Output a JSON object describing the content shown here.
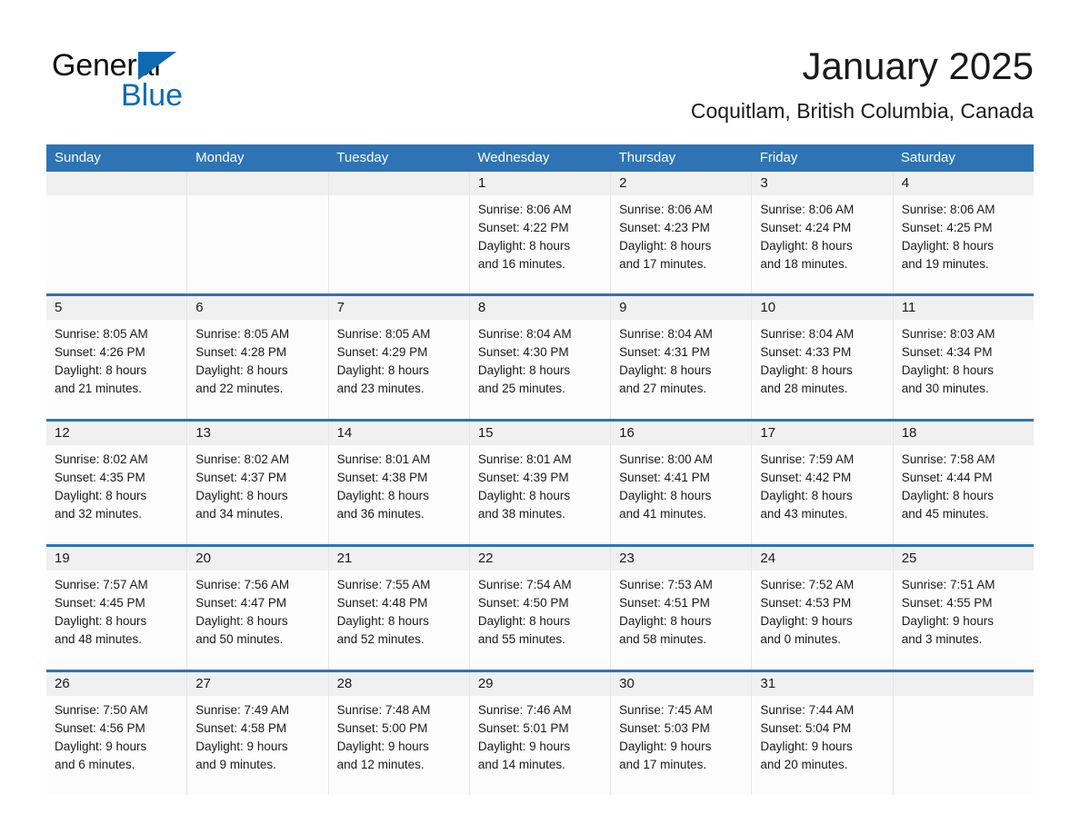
{
  "logo": {
    "word_one": "General",
    "word_two": "Blue",
    "triangle_color": "#0f6ab4",
    "icon": "triangle-icon"
  },
  "header": {
    "month_title": "January 2025",
    "location": "Coquitlam, British Columbia, Canada"
  },
  "theme": {
    "header_blue": "#2e74b5",
    "day_bar_gray": "#f0f0f0",
    "cell_background": "#fcfcfc",
    "text_color": "#1a1a1a"
  },
  "weekdays": [
    "Sunday",
    "Monday",
    "Tuesday",
    "Wednesday",
    "Thursday",
    "Friday",
    "Saturday"
  ],
  "weeks": [
    [
      {
        "empty": true
      },
      {
        "empty": true
      },
      {
        "empty": true
      },
      {
        "day": "1",
        "sunrise": "Sunrise: 8:06 AM",
        "sunset": "Sunset: 4:22 PM",
        "daylight1": "Daylight: 8 hours",
        "daylight2": "and 16 minutes."
      },
      {
        "day": "2",
        "sunrise": "Sunrise: 8:06 AM",
        "sunset": "Sunset: 4:23 PM",
        "daylight1": "Daylight: 8 hours",
        "daylight2": "and 17 minutes."
      },
      {
        "day": "3",
        "sunrise": "Sunrise: 8:06 AM",
        "sunset": "Sunset: 4:24 PM",
        "daylight1": "Daylight: 8 hours",
        "daylight2": "and 18 minutes."
      },
      {
        "day": "4",
        "sunrise": "Sunrise: 8:06 AM",
        "sunset": "Sunset: 4:25 PM",
        "daylight1": "Daylight: 8 hours",
        "daylight2": "and 19 minutes."
      }
    ],
    [
      {
        "day": "5",
        "sunrise": "Sunrise: 8:05 AM",
        "sunset": "Sunset: 4:26 PM",
        "daylight1": "Daylight: 8 hours",
        "daylight2": "and 21 minutes."
      },
      {
        "day": "6",
        "sunrise": "Sunrise: 8:05 AM",
        "sunset": "Sunset: 4:28 PM",
        "daylight1": "Daylight: 8 hours",
        "daylight2": "and 22 minutes."
      },
      {
        "day": "7",
        "sunrise": "Sunrise: 8:05 AM",
        "sunset": "Sunset: 4:29 PM",
        "daylight1": "Daylight: 8 hours",
        "daylight2": "and 23 minutes."
      },
      {
        "day": "8",
        "sunrise": "Sunrise: 8:04 AM",
        "sunset": "Sunset: 4:30 PM",
        "daylight1": "Daylight: 8 hours",
        "daylight2": "and 25 minutes."
      },
      {
        "day": "9",
        "sunrise": "Sunrise: 8:04 AM",
        "sunset": "Sunset: 4:31 PM",
        "daylight1": "Daylight: 8 hours",
        "daylight2": "and 27 minutes."
      },
      {
        "day": "10",
        "sunrise": "Sunrise: 8:04 AM",
        "sunset": "Sunset: 4:33 PM",
        "daylight1": "Daylight: 8 hours",
        "daylight2": "and 28 minutes."
      },
      {
        "day": "11",
        "sunrise": "Sunrise: 8:03 AM",
        "sunset": "Sunset: 4:34 PM",
        "daylight1": "Daylight: 8 hours",
        "daylight2": "and 30 minutes."
      }
    ],
    [
      {
        "day": "12",
        "sunrise": "Sunrise: 8:02 AM",
        "sunset": "Sunset: 4:35 PM",
        "daylight1": "Daylight: 8 hours",
        "daylight2": "and 32 minutes."
      },
      {
        "day": "13",
        "sunrise": "Sunrise: 8:02 AM",
        "sunset": "Sunset: 4:37 PM",
        "daylight1": "Daylight: 8 hours",
        "daylight2": "and 34 minutes."
      },
      {
        "day": "14",
        "sunrise": "Sunrise: 8:01 AM",
        "sunset": "Sunset: 4:38 PM",
        "daylight1": "Daylight: 8 hours",
        "daylight2": "and 36 minutes."
      },
      {
        "day": "15",
        "sunrise": "Sunrise: 8:01 AM",
        "sunset": "Sunset: 4:39 PM",
        "daylight1": "Daylight: 8 hours",
        "daylight2": "and 38 minutes."
      },
      {
        "day": "16",
        "sunrise": "Sunrise: 8:00 AM",
        "sunset": "Sunset: 4:41 PM",
        "daylight1": "Daylight: 8 hours",
        "daylight2": "and 41 minutes."
      },
      {
        "day": "17",
        "sunrise": "Sunrise: 7:59 AM",
        "sunset": "Sunset: 4:42 PM",
        "daylight1": "Daylight: 8 hours",
        "daylight2": "and 43 minutes."
      },
      {
        "day": "18",
        "sunrise": "Sunrise: 7:58 AM",
        "sunset": "Sunset: 4:44 PM",
        "daylight1": "Daylight: 8 hours",
        "daylight2": "and 45 minutes."
      }
    ],
    [
      {
        "day": "19",
        "sunrise": "Sunrise: 7:57 AM",
        "sunset": "Sunset: 4:45 PM",
        "daylight1": "Daylight: 8 hours",
        "daylight2": "and 48 minutes."
      },
      {
        "day": "20",
        "sunrise": "Sunrise: 7:56 AM",
        "sunset": "Sunset: 4:47 PM",
        "daylight1": "Daylight: 8 hours",
        "daylight2": "and 50 minutes."
      },
      {
        "day": "21",
        "sunrise": "Sunrise: 7:55 AM",
        "sunset": "Sunset: 4:48 PM",
        "daylight1": "Daylight: 8 hours",
        "daylight2": "and 52 minutes."
      },
      {
        "day": "22",
        "sunrise": "Sunrise: 7:54 AM",
        "sunset": "Sunset: 4:50 PM",
        "daylight1": "Daylight: 8 hours",
        "daylight2": "and 55 minutes."
      },
      {
        "day": "23",
        "sunrise": "Sunrise: 7:53 AM",
        "sunset": "Sunset: 4:51 PM",
        "daylight1": "Daylight: 8 hours",
        "daylight2": "and 58 minutes."
      },
      {
        "day": "24",
        "sunrise": "Sunrise: 7:52 AM",
        "sunset": "Sunset: 4:53 PM",
        "daylight1": "Daylight: 9 hours",
        "daylight2": "and 0 minutes."
      },
      {
        "day": "25",
        "sunrise": "Sunrise: 7:51 AM",
        "sunset": "Sunset: 4:55 PM",
        "daylight1": "Daylight: 9 hours",
        "daylight2": "and 3 minutes."
      }
    ],
    [
      {
        "day": "26",
        "sunrise": "Sunrise: 7:50 AM",
        "sunset": "Sunset: 4:56 PM",
        "daylight1": "Daylight: 9 hours",
        "daylight2": "and 6 minutes."
      },
      {
        "day": "27",
        "sunrise": "Sunrise: 7:49 AM",
        "sunset": "Sunset: 4:58 PM",
        "daylight1": "Daylight: 9 hours",
        "daylight2": "and 9 minutes."
      },
      {
        "day": "28",
        "sunrise": "Sunrise: 7:48 AM",
        "sunset": "Sunset: 5:00 PM",
        "daylight1": "Daylight: 9 hours",
        "daylight2": "and 12 minutes."
      },
      {
        "day": "29",
        "sunrise": "Sunrise: 7:46 AM",
        "sunset": "Sunset: 5:01 PM",
        "daylight1": "Daylight: 9 hours",
        "daylight2": "and 14 minutes."
      },
      {
        "day": "30",
        "sunrise": "Sunrise: 7:45 AM",
        "sunset": "Sunset: 5:03 PM",
        "daylight1": "Daylight: 9 hours",
        "daylight2": "and 17 minutes."
      },
      {
        "day": "31",
        "sunrise": "Sunrise: 7:44 AM",
        "sunset": "Sunset: 5:04 PM",
        "daylight1": "Daylight: 9 hours",
        "daylight2": "and 20 minutes."
      },
      {
        "empty": true
      }
    ]
  ]
}
